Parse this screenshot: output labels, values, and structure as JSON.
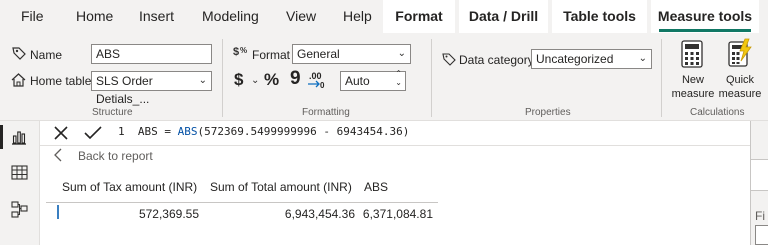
{
  "ribbon_tabs": {
    "file": "File",
    "home": "Home",
    "insert": "Insert",
    "modeling": "Modeling",
    "view": "View",
    "help": "Help",
    "format": "Format",
    "data_drill": "Data / Drill",
    "table_tools": "Table tools",
    "measure_tools": "Measure tools"
  },
  "structure": {
    "name_label": "Name",
    "name_value": "ABS",
    "home_table_label": "Home table",
    "home_table_value": "SLS Order Detials_...",
    "group_label": "Structure"
  },
  "formatting": {
    "format_label": "Format",
    "format_value": "General",
    "currency_symbol": "$",
    "percent_symbol": "%",
    "comma_symbol": "9",
    "decimal_symbol": ".00",
    "decimals_value": "Auto",
    "group_label": "Formatting"
  },
  "properties": {
    "data_category_label": "Data category",
    "data_category_value": "Uncategorized",
    "group_label": "Properties"
  },
  "calculations": {
    "new_measure_line1": "New",
    "new_measure_line2": "measure",
    "quick_measure_line1": "Quick",
    "quick_measure_line2": "measure",
    "group_label": "Calculations"
  },
  "formula_bar": {
    "line_number": "1",
    "formula_prefix": "ABS = ",
    "formula_func": "ABS",
    "formula_args": "(572369.5499999996 - 6943454.36)"
  },
  "back_to_report": "Back to report",
  "table": {
    "headers": [
      "Sum of Tax amount (INR)",
      "Sum of Total amount (INR)",
      "ABS"
    ],
    "row": [
      "572,369.55",
      "6,943,454.36",
      "6,371,084.81"
    ]
  },
  "right_pane": {
    "partial_label": "Fi"
  },
  "colors": {
    "accent_green": "#117865",
    "ribbon_bg": "#f3f2f1",
    "function_blue": "#0451a5"
  }
}
